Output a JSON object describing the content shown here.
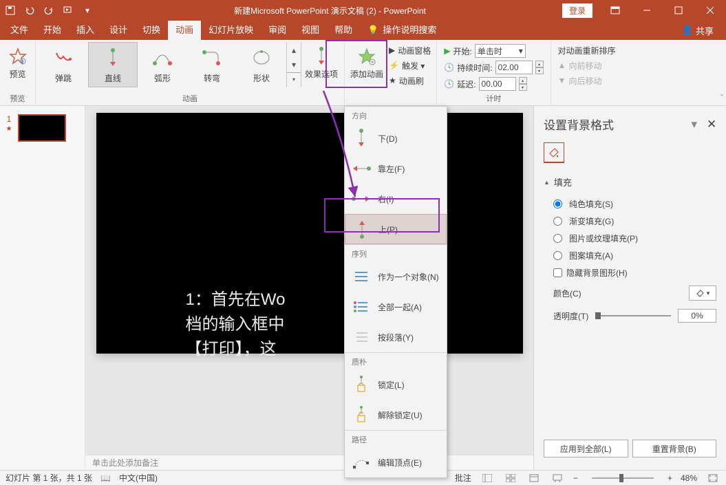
{
  "titlebar": {
    "title": "新建Microsoft PowerPoint 演示文稿 (2)  -  PowerPoint",
    "login": "登录"
  },
  "tabs": {
    "file": "文件",
    "home": "开始",
    "insert": "插入",
    "design": "设计",
    "transition": "切换",
    "animation": "动画",
    "slideshow": "幻灯片放映",
    "review": "审阅",
    "view": "视图",
    "help": "帮助",
    "tellme": "操作说明搜索",
    "share": "共享"
  },
  "ribbon": {
    "preview": {
      "label": "预览",
      "group": "预览"
    },
    "gallery": {
      "items": [
        "弹跳",
        "直线",
        "弧形",
        "转弯",
        "形状"
      ],
      "selected": 1,
      "group": "动画"
    },
    "effect_options": "效果选项",
    "add_animation": "添加动画",
    "adv": {
      "pane": "动画窗格",
      "trigger": "触发 ▾",
      "painter": "动画刷"
    },
    "timing": {
      "start_label": "开始:",
      "start_value": "单击时",
      "duration_label": "持续时间:",
      "duration_value": "02.00",
      "delay_label": "延迟:",
      "delay_value": "00.00",
      "group": "计时"
    },
    "reorder": {
      "title": "对动画重新排序",
      "forward": "向前移动",
      "backward": "向后移动"
    }
  },
  "dropdown": {
    "sections": {
      "direction": "方向",
      "sequence": "序列",
      "locked": "质朴",
      "path": "路径"
    },
    "direction": {
      "down": "下(D)",
      "left": "靠左(F)",
      "right": "右(I)",
      "up": "上(P)"
    },
    "sequence": {
      "as_one": "作为一个对象(N)",
      "all_at_once": "全部一起(A)",
      "by_paragraph": "按段落(Y)"
    },
    "locked": {
      "lock": "锁定(L)",
      "unlock": "解除锁定(U)"
    },
    "path": {
      "edit_points": "编辑顶点(E)"
    }
  },
  "overlay_text": {
    "line1": "1：首先在Wo",
    "line2": "档的输入框中",
    "line3": "【打印】，这"
  },
  "notes_placeholder": "单击此处添加备注",
  "rightpane": {
    "title": "设置背景格式",
    "fill_section": "填充",
    "solid": "纯色填充(S)",
    "gradient": "渐变填充(G)",
    "picture": "图片或纹理填充(P)",
    "pattern": "图案填充(A)",
    "hide_graphics": "隐藏背景图形(H)",
    "color_label": "颜色(C)",
    "transparency_label": "透明度(T)",
    "transparency_value": "0%",
    "apply_all": "应用到全部(L)",
    "reset": "重置背景(B)"
  },
  "statusbar": {
    "slide_info": "幻灯片 第 1 张，共 1 张",
    "language": "中文(中国)",
    "notes": "批注",
    "zoom": "48%"
  }
}
